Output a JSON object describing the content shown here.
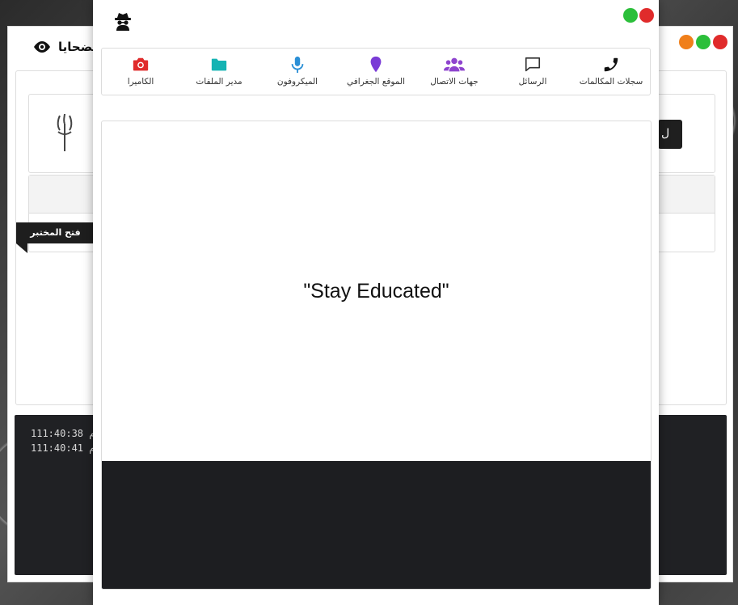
{
  "background_window": {
    "title": "الضحايا",
    "button_text": "ل",
    "ribbon_label": "فتح المختبر",
    "log_lines": [
      "1م 11:40:38",
      "1م 11:40:41"
    ],
    "dots": [
      "#f07f1a",
      "#2bbf3a",
      "#e02b2b"
    ]
  },
  "modal": {
    "dots": [
      "#2bbf3a",
      "#e02b2b"
    ],
    "tools": [
      {
        "label": "سجلات المكالمات",
        "icon": "phone-icon",
        "color": "#111111"
      },
      {
        "label": "الرسائل",
        "icon": "message-icon",
        "color": "#333333"
      },
      {
        "label": "جهات الاتصال",
        "icon": "users-icon",
        "color": "#8e44ce"
      },
      {
        "label": "الموقع الجغرافي",
        "icon": "map-pin-icon",
        "color": "#7a3bd6"
      },
      {
        "label": "الميكروفون",
        "icon": "microphone-icon",
        "color": "#2a8fd6"
      },
      {
        "label": "مدير الملفات",
        "icon": "folder-icon",
        "color": "#14b3b3"
      },
      {
        "label": "الكاميرا",
        "icon": "camera-icon",
        "color": "#e02b2b"
      }
    ],
    "display_text": "\"Stay Educated\""
  }
}
